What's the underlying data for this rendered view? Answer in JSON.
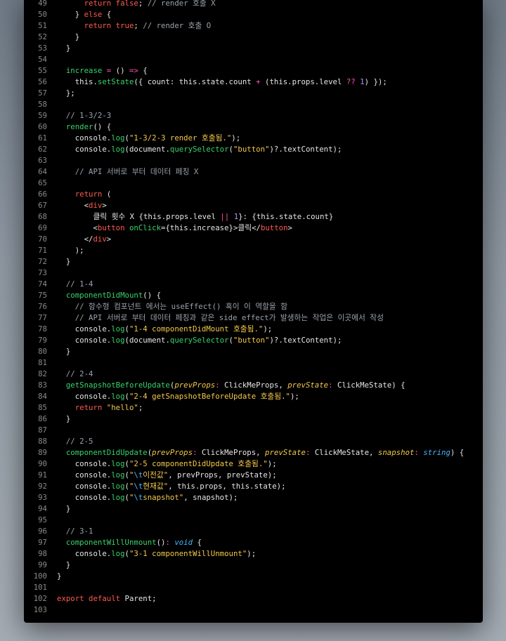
{
  "editor": {
    "lines": [
      {
        "n": "49",
        "tokens": [
          {
            "t": "      "
          },
          {
            "t": "return",
            "c": "kw"
          },
          {
            "t": " "
          },
          {
            "t": "false",
            "c": "kw"
          },
          {
            "t": "; "
          },
          {
            "t": "// render 호출 X",
            "c": "cm"
          }
        ]
      },
      {
        "n": "50",
        "tokens": [
          {
            "t": "    } "
          },
          {
            "t": "else",
            "c": "kw"
          },
          {
            "t": " {"
          }
        ]
      },
      {
        "n": "51",
        "tokens": [
          {
            "t": "      "
          },
          {
            "t": "return",
            "c": "kw"
          },
          {
            "t": " "
          },
          {
            "t": "true",
            "c": "kw"
          },
          {
            "t": "; "
          },
          {
            "t": "// render 호출 O",
            "c": "cm"
          }
        ]
      },
      {
        "n": "52",
        "tokens": [
          {
            "t": "    }"
          }
        ]
      },
      {
        "n": "53",
        "tokens": [
          {
            "t": "  }"
          }
        ]
      },
      {
        "n": "54",
        "tokens": []
      },
      {
        "n": "55",
        "tokens": [
          {
            "t": "  "
          },
          {
            "t": "increase",
            "c": "fn"
          },
          {
            "t": " "
          },
          {
            "t": "=",
            "c": "op"
          },
          {
            "t": " () "
          },
          {
            "t": "=>",
            "c": "op"
          },
          {
            "t": " {"
          }
        ]
      },
      {
        "n": "56",
        "tokens": [
          {
            "t": "    this."
          },
          {
            "t": "setState",
            "c": "fn"
          },
          {
            "t": "({ count: this.state.count "
          },
          {
            "t": "+",
            "c": "op"
          },
          {
            "t": " (this.props.level "
          },
          {
            "t": "??",
            "c": "op"
          },
          {
            "t": " "
          },
          {
            "t": "1",
            "c": "num"
          },
          {
            "t": ") });"
          }
        ]
      },
      {
        "n": "57",
        "tokens": [
          {
            "t": "  };"
          }
        ]
      },
      {
        "n": "58",
        "tokens": []
      },
      {
        "n": "59",
        "tokens": [
          {
            "t": "  "
          },
          {
            "t": "// 1-3/2-3",
            "c": "cm"
          }
        ]
      },
      {
        "n": "60",
        "tokens": [
          {
            "t": "  "
          },
          {
            "t": "render",
            "c": "fn"
          },
          {
            "t": "() {"
          }
        ]
      },
      {
        "n": "61",
        "tokens": [
          {
            "t": "    console."
          },
          {
            "t": "log",
            "c": "fn"
          },
          {
            "t": "("
          },
          {
            "t": "\"1-3/2-3 render 호출됨.\"",
            "c": "str"
          },
          {
            "t": ");"
          }
        ]
      },
      {
        "n": "62",
        "tokens": [
          {
            "t": "    console."
          },
          {
            "t": "log",
            "c": "fn"
          },
          {
            "t": "(document."
          },
          {
            "t": "querySelector",
            "c": "fn"
          },
          {
            "t": "("
          },
          {
            "t": "\"button\"",
            "c": "str"
          },
          {
            "t": ")?.textContent);"
          }
        ]
      },
      {
        "n": "63",
        "tokens": []
      },
      {
        "n": "64",
        "tokens": [
          {
            "t": "    "
          },
          {
            "t": "// API 서버로 부터 데이터 페칭 X",
            "c": "cm"
          }
        ]
      },
      {
        "n": "65",
        "tokens": []
      },
      {
        "n": "66",
        "tokens": [
          {
            "t": "    "
          },
          {
            "t": "return",
            "c": "kw"
          },
          {
            "t": " ("
          }
        ]
      },
      {
        "n": "67",
        "tokens": [
          {
            "t": "      <"
          },
          {
            "t": "div",
            "c": "tag"
          },
          {
            "t": ">"
          }
        ]
      },
      {
        "n": "68",
        "tokens": [
          {
            "t": "        클릭 횟수 X {this.props.level "
          },
          {
            "t": "||",
            "c": "op"
          },
          {
            "t": " "
          },
          {
            "t": "1",
            "c": "num"
          },
          {
            "t": "}: {this.state.count}"
          }
        ]
      },
      {
        "n": "69",
        "tokens": [
          {
            "t": "        <"
          },
          {
            "t": "button",
            "c": "tag"
          },
          {
            "t": " "
          },
          {
            "t": "onClick",
            "c": "fn"
          },
          {
            "t": "={this.increase}>클릭</"
          },
          {
            "t": "button",
            "c": "tag"
          },
          {
            "t": ">"
          }
        ]
      },
      {
        "n": "70",
        "tokens": [
          {
            "t": "      </"
          },
          {
            "t": "div",
            "c": "tag"
          },
          {
            "t": ">"
          }
        ]
      },
      {
        "n": "71",
        "tokens": [
          {
            "t": "    );"
          }
        ]
      },
      {
        "n": "72",
        "tokens": [
          {
            "t": "  }"
          }
        ]
      },
      {
        "n": "73",
        "tokens": []
      },
      {
        "n": "74",
        "tokens": [
          {
            "t": "  "
          },
          {
            "t": "// 1-4",
            "c": "cm"
          }
        ]
      },
      {
        "n": "75",
        "tokens": [
          {
            "t": "  "
          },
          {
            "t": "componentDidMount",
            "c": "fn"
          },
          {
            "t": "() {"
          }
        ]
      },
      {
        "n": "76",
        "tokens": [
          {
            "t": "    "
          },
          {
            "t": "// 함수형 컴포넌트 에서는 useEffect() 혹이 이 역할을 함",
            "c": "cm"
          }
        ]
      },
      {
        "n": "77",
        "tokens": [
          {
            "t": "    "
          },
          {
            "t": "// API 서버로 부터 데이터 페칭과 같은 side effect가 발생하는 작업은 이곳에서 작성",
            "c": "cm"
          }
        ]
      },
      {
        "n": "78",
        "tokens": [
          {
            "t": "    console."
          },
          {
            "t": "log",
            "c": "fn"
          },
          {
            "t": "("
          },
          {
            "t": "\"1-4 componentDidMount 호출됨.\"",
            "c": "str"
          },
          {
            "t": ");"
          }
        ]
      },
      {
        "n": "79",
        "tokens": [
          {
            "t": "    console."
          },
          {
            "t": "log",
            "c": "fn"
          },
          {
            "t": "(document."
          },
          {
            "t": "querySelector",
            "c": "fn"
          },
          {
            "t": "("
          },
          {
            "t": "\"button\"",
            "c": "str"
          },
          {
            "t": ")?.textContent);"
          }
        ]
      },
      {
        "n": "80",
        "tokens": [
          {
            "t": "  }"
          }
        ]
      },
      {
        "n": "81",
        "tokens": []
      },
      {
        "n": "82",
        "tokens": [
          {
            "t": "  "
          },
          {
            "t": "// 2-4",
            "c": "cm"
          }
        ]
      },
      {
        "n": "83",
        "tokens": [
          {
            "t": "  "
          },
          {
            "t": "getSnapshotBeforeUpdate",
            "c": "fn"
          },
          {
            "t": "("
          },
          {
            "t": "prevProps",
            "c": "param"
          },
          {
            "t": ": ",
            "c": "op"
          },
          {
            "t": "ClickMeProps, "
          },
          {
            "t": "prevState",
            "c": "param"
          },
          {
            "t": ": ",
            "c": "op"
          },
          {
            "t": "ClickMeState) {"
          }
        ]
      },
      {
        "n": "84",
        "tokens": [
          {
            "t": "    console."
          },
          {
            "t": "log",
            "c": "fn"
          },
          {
            "t": "("
          },
          {
            "t": "\"2-4 getSnapshotBeforeUpdate 호출됨.\"",
            "c": "str"
          },
          {
            "t": ");"
          }
        ]
      },
      {
        "n": "85",
        "tokens": [
          {
            "t": "    "
          },
          {
            "t": "return",
            "c": "kw"
          },
          {
            "t": " "
          },
          {
            "t": "\"hello\"",
            "c": "str"
          },
          {
            "t": ";"
          }
        ]
      },
      {
        "n": "86",
        "tokens": [
          {
            "t": "  }"
          }
        ]
      },
      {
        "n": "87",
        "tokens": []
      },
      {
        "n": "88",
        "tokens": [
          {
            "t": "  "
          },
          {
            "t": "// 2-5",
            "c": "cm"
          }
        ]
      },
      {
        "n": "89",
        "tokens": [
          {
            "t": "  "
          },
          {
            "t": "componentDidUpdate",
            "c": "fn"
          },
          {
            "t": "("
          },
          {
            "t": "prevProps",
            "c": "param"
          },
          {
            "t": ": ",
            "c": "op"
          },
          {
            "t": "ClickMeProps, "
          },
          {
            "t": "prevState",
            "c": "param"
          },
          {
            "t": ": ",
            "c": "op"
          },
          {
            "t": "ClickMeState, "
          },
          {
            "t": "snapshot",
            "c": "param"
          },
          {
            "t": ": ",
            "c": "op"
          },
          {
            "t": "string",
            "c": "type"
          },
          {
            "t": ") {"
          }
        ]
      },
      {
        "n": "90",
        "tokens": [
          {
            "t": "    console."
          },
          {
            "t": "log",
            "c": "fn"
          },
          {
            "t": "("
          },
          {
            "t": "\"2-5 componentDidUpdate 호출됨.\"",
            "c": "str"
          },
          {
            "t": ");"
          }
        ]
      },
      {
        "n": "91",
        "tokens": [
          {
            "t": "    console."
          },
          {
            "t": "log",
            "c": "fn"
          },
          {
            "t": "("
          },
          {
            "t": "\"",
            "c": "str"
          },
          {
            "t": "\\t",
            "c": "esc"
          },
          {
            "t": "이전값\"",
            "c": "str"
          },
          {
            "t": ", prevProps, prevState);"
          }
        ]
      },
      {
        "n": "92",
        "tokens": [
          {
            "t": "    console."
          },
          {
            "t": "log",
            "c": "fn"
          },
          {
            "t": "("
          },
          {
            "t": "\"",
            "c": "str"
          },
          {
            "t": "\\t",
            "c": "esc"
          },
          {
            "t": "현재값\"",
            "c": "str"
          },
          {
            "t": ", this.props, this.state);"
          }
        ]
      },
      {
        "n": "93",
        "tokens": [
          {
            "t": "    console."
          },
          {
            "t": "log",
            "c": "fn"
          },
          {
            "t": "("
          },
          {
            "t": "\"",
            "c": "str"
          },
          {
            "t": "\\t",
            "c": "esc"
          },
          {
            "t": "snapshot\"",
            "c": "str"
          },
          {
            "t": ", snapshot);"
          }
        ]
      },
      {
        "n": "94",
        "tokens": [
          {
            "t": "  }"
          }
        ]
      },
      {
        "n": "95",
        "tokens": []
      },
      {
        "n": "96",
        "tokens": [
          {
            "t": "  "
          },
          {
            "t": "// 3-1",
            "c": "cm"
          }
        ]
      },
      {
        "n": "97",
        "tokens": [
          {
            "t": "  "
          },
          {
            "t": "componentWillUnmount",
            "c": "fn"
          },
          {
            "t": "()"
          },
          {
            "t": ": ",
            "c": "op"
          },
          {
            "t": "void",
            "c": "type"
          },
          {
            "t": " {"
          }
        ]
      },
      {
        "n": "98",
        "tokens": [
          {
            "t": "    console."
          },
          {
            "t": "log",
            "c": "fn"
          },
          {
            "t": "("
          },
          {
            "t": "\"3-1 componentWillUnmount\"",
            "c": "str"
          },
          {
            "t": ");"
          }
        ]
      },
      {
        "n": "99",
        "tokens": [
          {
            "t": "  }"
          }
        ]
      },
      {
        "n": "100",
        "tokens": [
          {
            "t": "}"
          }
        ]
      },
      {
        "n": "101",
        "tokens": []
      },
      {
        "n": "102",
        "tokens": [
          {
            "t": "export",
            "c": "kw"
          },
          {
            "t": " "
          },
          {
            "t": "default",
            "c": "kw"
          },
          {
            "t": " Parent;"
          }
        ]
      },
      {
        "n": "103",
        "tokens": []
      }
    ]
  },
  "colors": {
    "background": "#000000",
    "keyword": "#ff5a4f",
    "function": "#39d36b",
    "string": "#f4c94a",
    "comment": "#9aa2ab",
    "operator": "#ff4fb0",
    "number": "#b38cff",
    "type": "#46b4ff"
  }
}
